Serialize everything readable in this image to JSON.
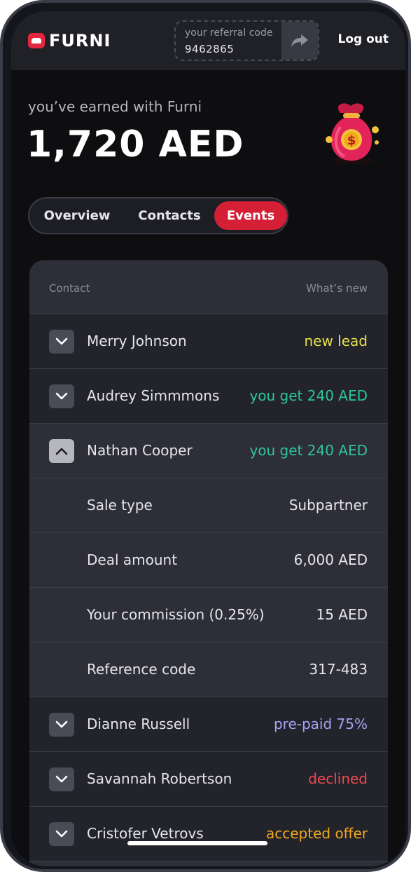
{
  "header": {
    "brand": "FURNI",
    "referral_label": "your referral code",
    "referral_code": "9462865",
    "logout": "Log out"
  },
  "earnings": {
    "label": "you’ve earned with Furni",
    "amount": "1,720 AED"
  },
  "tabs": [
    {
      "label": "Overview",
      "active": false
    },
    {
      "label": "Contacts",
      "active": false
    },
    {
      "label": "Events",
      "active": true
    }
  ],
  "table": {
    "col_contact": "Contact",
    "col_whats_new": "What’s new",
    "rows": [
      {
        "name": "Merry Johnson",
        "status": "new lead",
        "status_color": "#e6e24a",
        "expanded": false
      },
      {
        "name": "Audrey Simmmons",
        "status": "you get 240 AED",
        "status_color": "#2fc49a",
        "expanded": false
      },
      {
        "name": "Nathan Cooper",
        "status": "you get 240 AED",
        "status_color": "#2fc49a",
        "expanded": true
      },
      {
        "name": "Dianne Russell",
        "status": "pre-paid 75%",
        "status_color": "#a7a5f0",
        "expanded": false
      },
      {
        "name": "Savannah Robertson",
        "status": "declined",
        "status_color": "#f0484f",
        "expanded": false
      },
      {
        "name": "Cristofer Vetrovs",
        "status": "accepted offer",
        "status_color": "#f0a91e",
        "expanded": false
      }
    ],
    "details": [
      {
        "label": "Sale type",
        "value": "Subpartner"
      },
      {
        "label": "Deal amount",
        "value": "6,000 AED"
      },
      {
        "label": "Your commission (0.25%)",
        "value": "15 AED"
      },
      {
        "label": "Reference code",
        "value": "317-483"
      }
    ]
  },
  "icons": {
    "logo": "furni-logo-icon",
    "share": "share-arrow-icon",
    "money": "money-bag-icon",
    "collapsed": "chevron-down-icon",
    "expanded": "chevron-up-icon"
  },
  "colors": {
    "accent": "#d51f37",
    "background": "#0e0e11",
    "card": "#2d2e38"
  }
}
